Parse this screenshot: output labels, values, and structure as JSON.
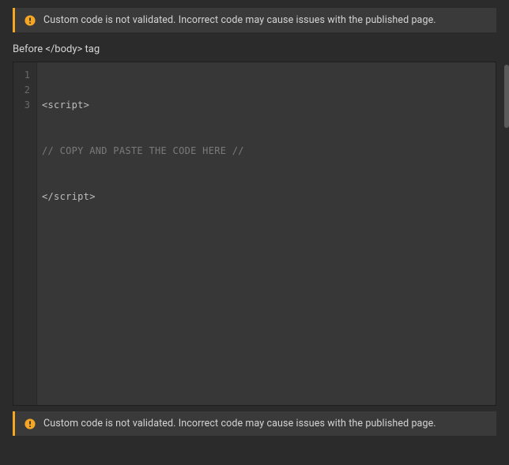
{
  "warnings": {
    "top": "Custom code is not validated. Incorrect code may cause issues with the published page.",
    "bottom": "Custom code is not validated. Incorrect code may cause issues with the published page."
  },
  "section_label": "Before </body> tag",
  "icon_names": {
    "warning": "warning-icon"
  },
  "code": {
    "gutter": [
      "1",
      "2",
      "3"
    ],
    "lines": {
      "l1": "<script>",
      "l2": "// COPY AND PASTE THE CODE HERE //",
      "l3": "</script>"
    }
  }
}
